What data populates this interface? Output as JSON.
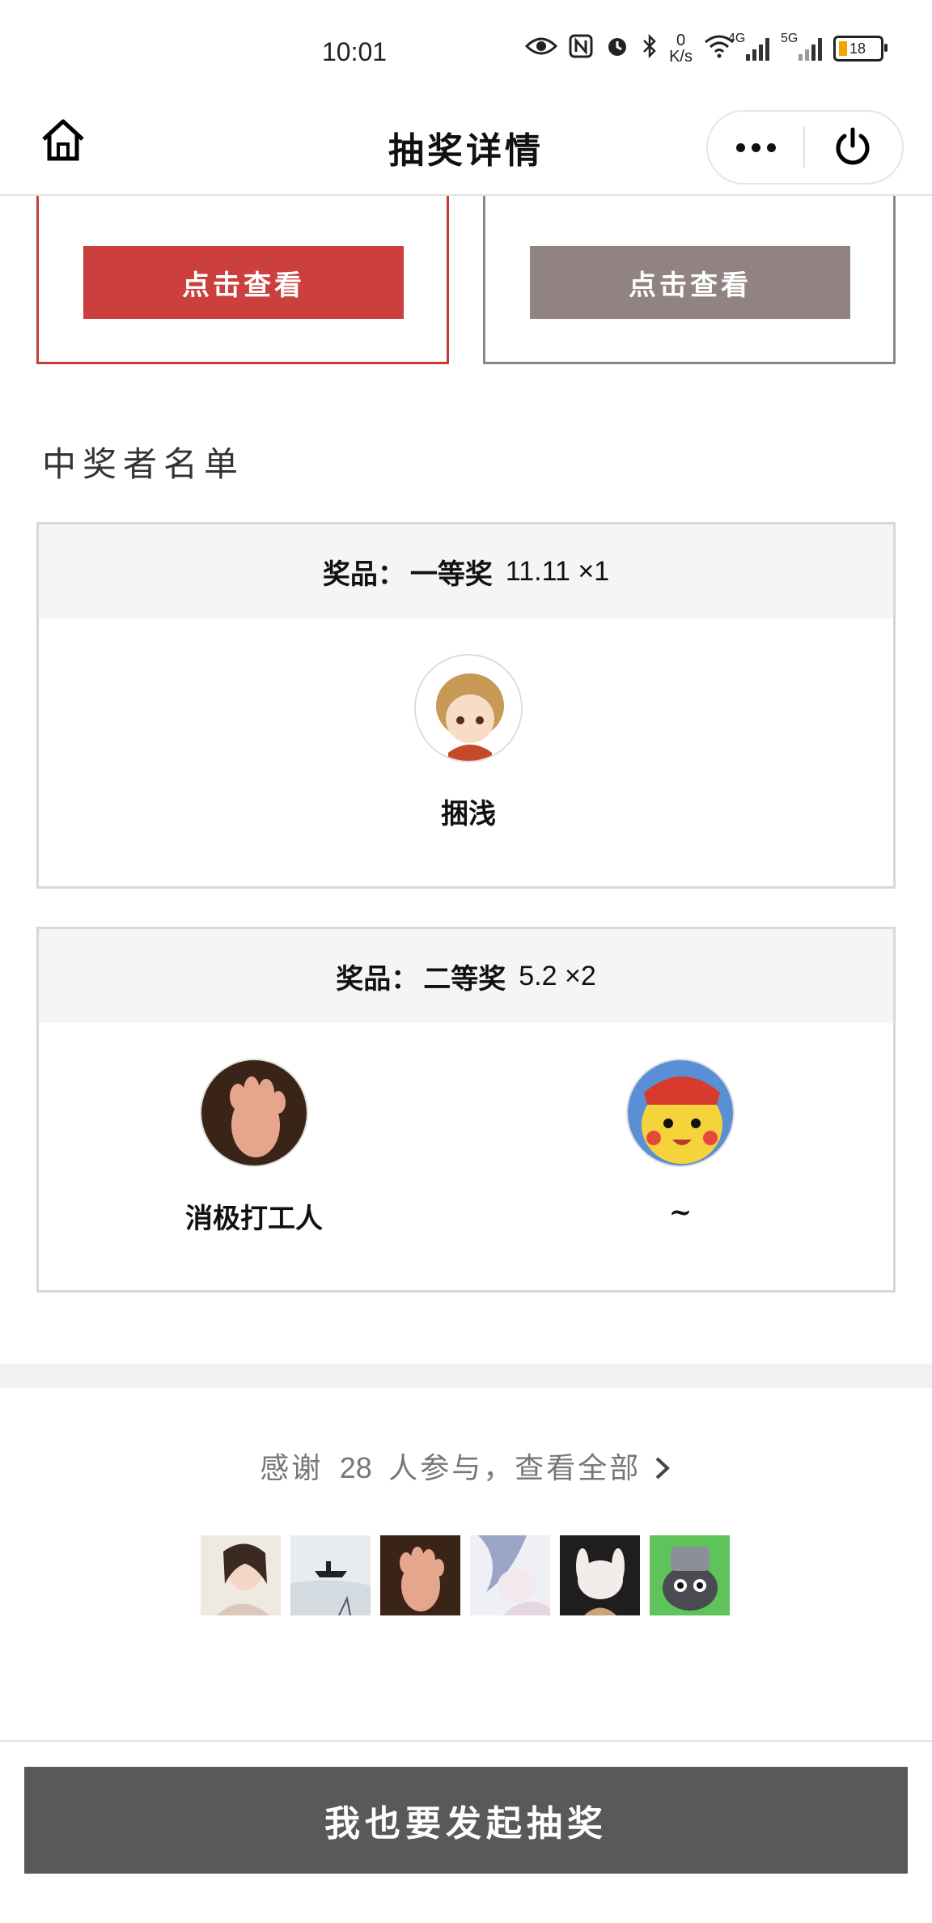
{
  "status_bar": {
    "time": "10:01",
    "net_speed_value": "0",
    "net_speed_unit": "K/s",
    "signal1_label": "4G",
    "signal2_label": "5G",
    "battery": "18",
    "icons": [
      "eye-icon",
      "nfc-icon",
      "alarm-icon",
      "bluetooth-icon",
      "wifi-icon",
      "signal-icon",
      "signal-icon",
      "battery-icon"
    ]
  },
  "nav": {
    "title": "抽奖详情"
  },
  "top_cards": {
    "left_button": "点击查看",
    "right_button": "点击查看"
  },
  "winners_section": {
    "title": "中奖者名单",
    "prizes": [
      {
        "label": "奖品：",
        "name": "一等奖",
        "amount": "11.11 ×1",
        "winners": [
          {
            "name": "捆浅"
          }
        ]
      },
      {
        "label": "奖品：",
        "name": "二等奖",
        "amount": "5.2 ×2",
        "winners": [
          {
            "name": "消极打工人"
          },
          {
            "name": "~"
          }
        ]
      }
    ]
  },
  "participants": {
    "prefix": "感谢",
    "count": "28",
    "suffix": "人参与，查看全部",
    "avatar_count_shown": 6
  },
  "cta": {
    "label": "我也要发起抽奖"
  },
  "colors": {
    "primary_red": "#cc3f3f",
    "muted_brown": "#928383",
    "cta_gray": "#595959"
  }
}
